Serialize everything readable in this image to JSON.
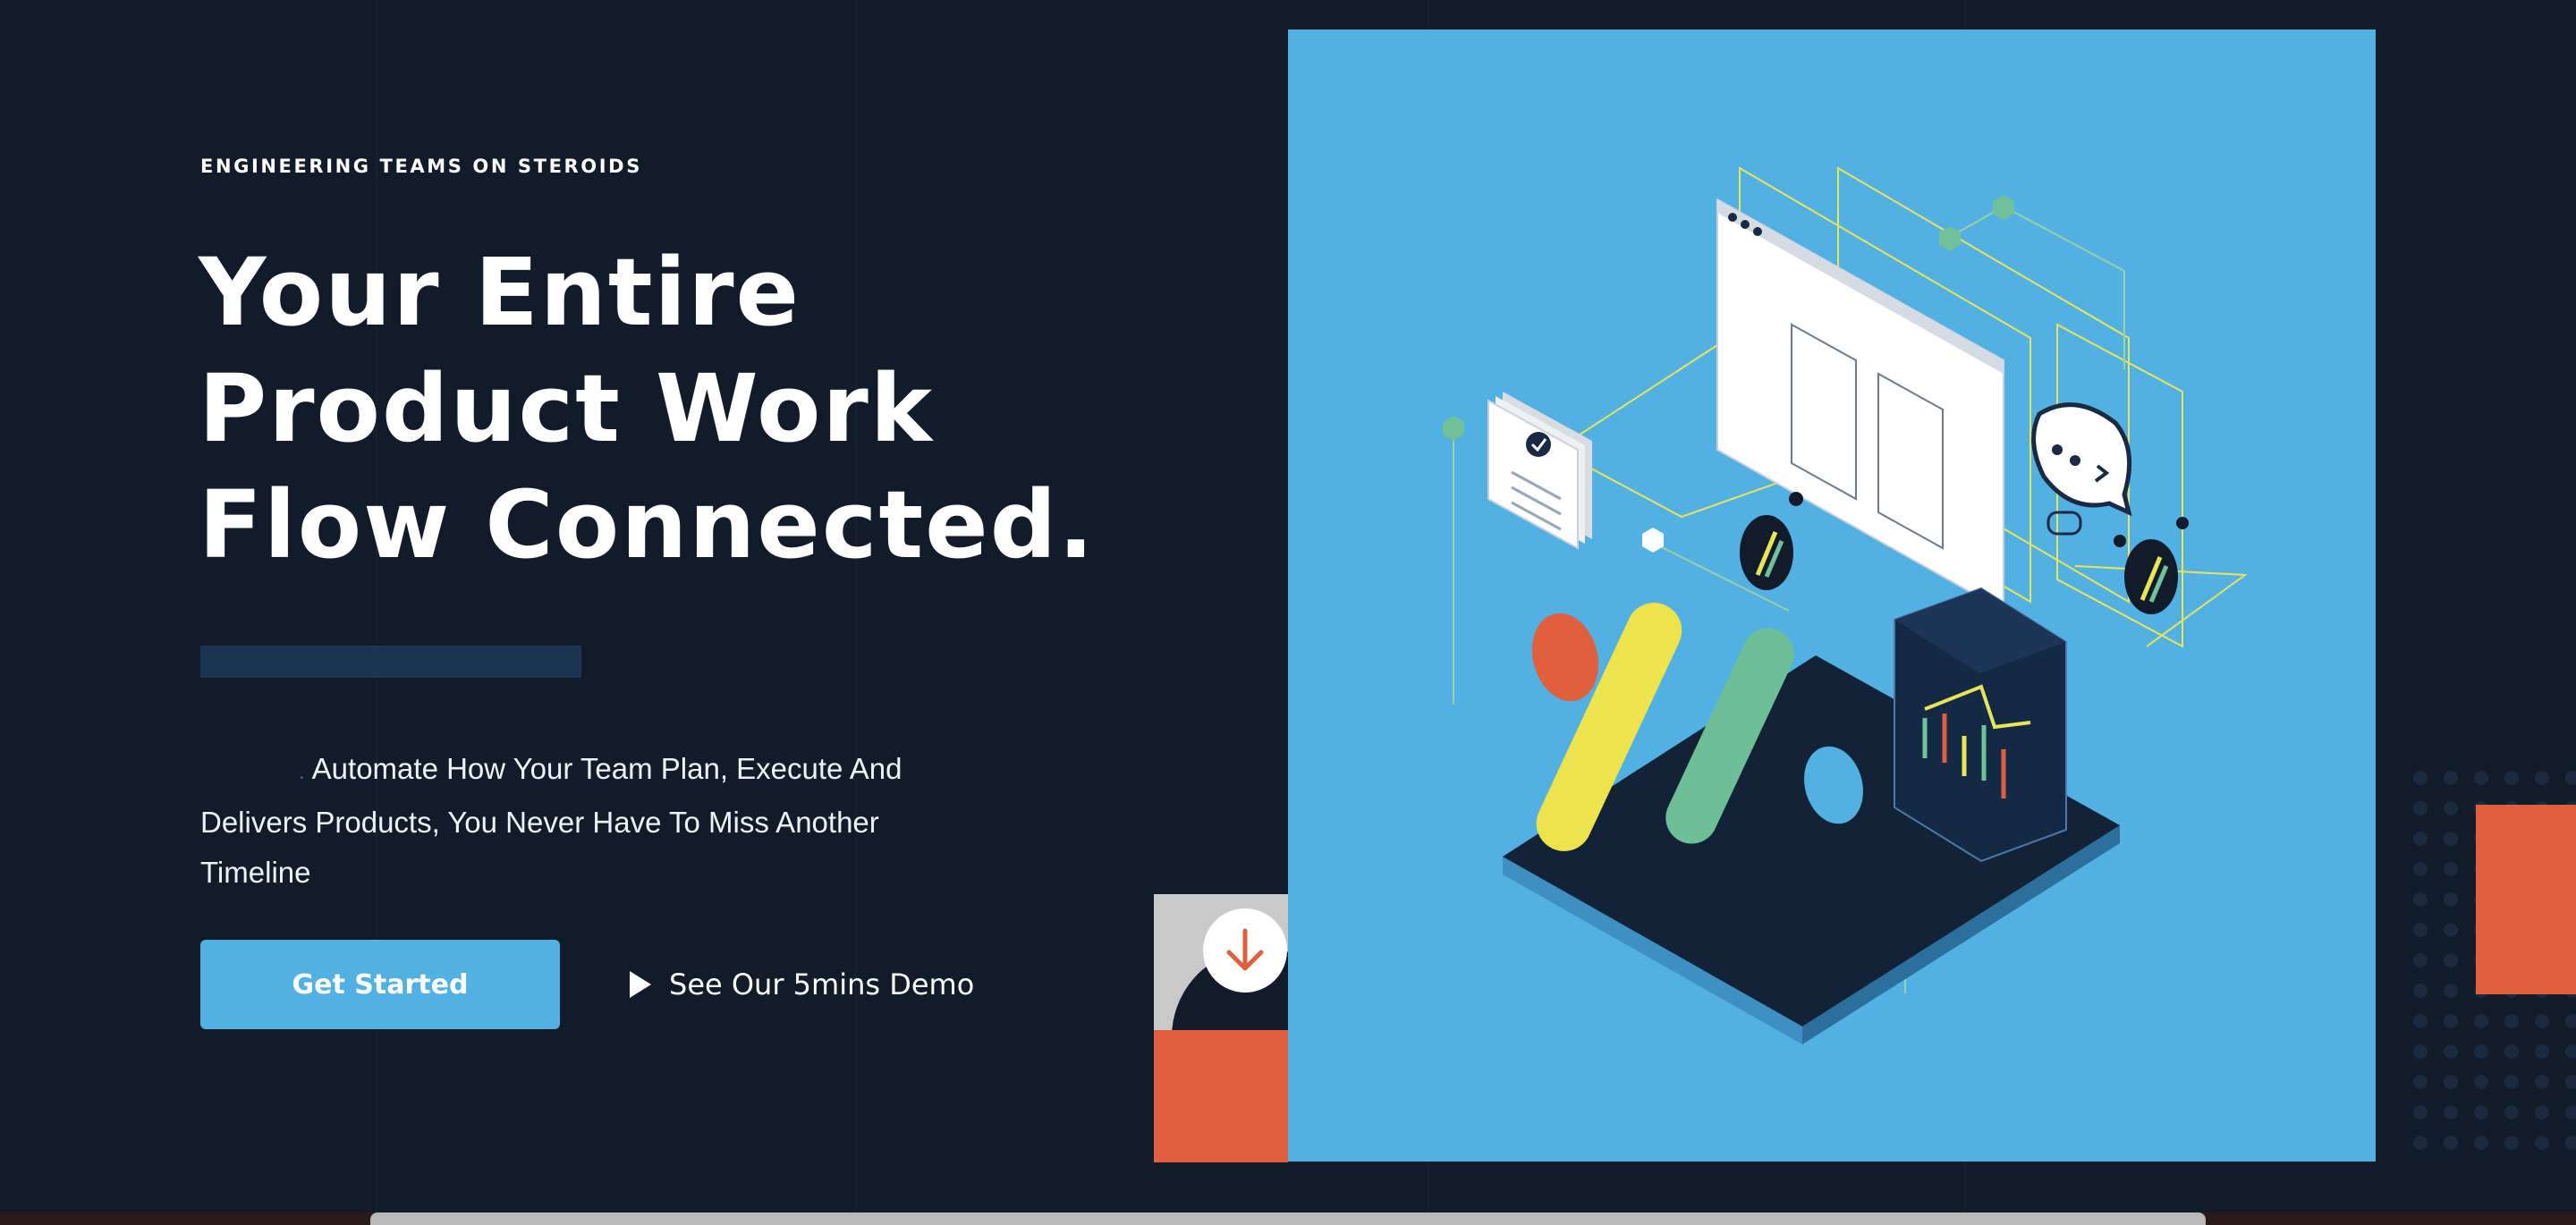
{
  "hero": {
    "eyebrow": "ENGINEERING TEAMS ON STEROIDS",
    "headline_lines": [
      "Your Entire",
      "Product Work",
      "Flow Connected."
    ],
    "description": "Automate How Your Team Plan, Execute And Delivers Products, You Never Have To Miss Another Timeline",
    "cta_primary": "Get Started",
    "cta_secondary": "See Our 5mins Demo"
  },
  "icons": {
    "play": "play-icon",
    "scroll_down": "arrow-down-icon",
    "illustration": "isometric-workflow-illustration"
  },
  "colors": {
    "background": "#111b2a",
    "accent_blue": "#52b0e3",
    "accent_orange": "#e0603e",
    "accent_bar": "#1b3552",
    "illustration_bg": "#53b0e3"
  }
}
